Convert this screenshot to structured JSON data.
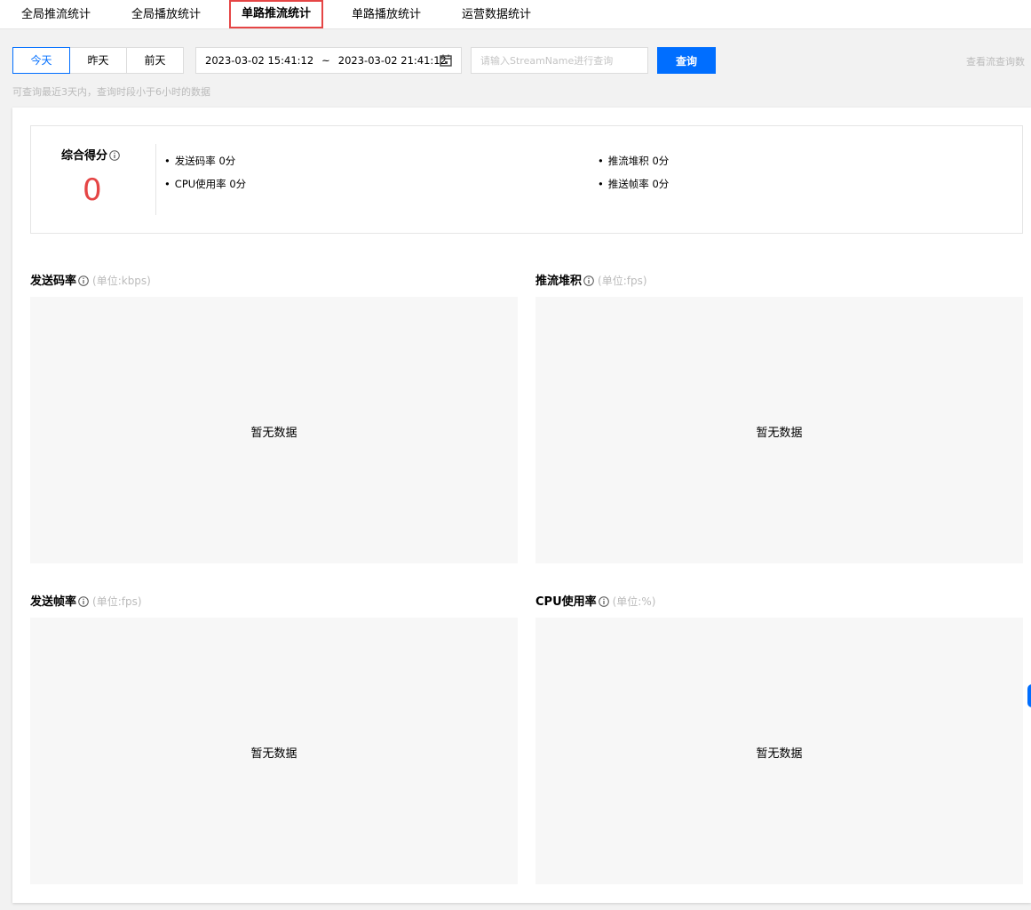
{
  "tabs": [
    {
      "label": "全局推流统计"
    },
    {
      "label": "全局播放统计"
    },
    {
      "label": "单路推流统计"
    },
    {
      "label": "单路播放统计"
    },
    {
      "label": "运营数据统计"
    }
  ],
  "toolbar": {
    "days": [
      "今天",
      "昨天",
      "前天"
    ],
    "date_start": "2023-03-02 15:41:12",
    "date_sep": "~",
    "date_end": "2023-03-02 21:41:12",
    "search_placeholder": "请输入StreamName进行查询",
    "query_label": "查询",
    "view_link": "查看流查询数",
    "hint": "可查询最近3天内，查询时段小于6小时的数据"
  },
  "score": {
    "title": "综合得分",
    "value": "0",
    "metrics": [
      "发送码率 0分",
      "推流堆积 0分",
      "CPU使用率 0分",
      "推送帧率 0分"
    ]
  },
  "charts": [
    {
      "title": "发送码率",
      "unit": "(单位:kbps)",
      "empty": "暂无数据"
    },
    {
      "title": "推流堆积",
      "unit": "(单位:fps)",
      "empty": "暂无数据"
    },
    {
      "title": "发送帧率",
      "unit": "(单位:fps)",
      "empty": "暂无数据"
    },
    {
      "title": "CPU使用率",
      "unit": "(单位:%)",
      "empty": "暂无数据"
    }
  ],
  "colors": {
    "accent": "#006eff",
    "score": "#e54545",
    "tab_highlight": "#e54545"
  }
}
